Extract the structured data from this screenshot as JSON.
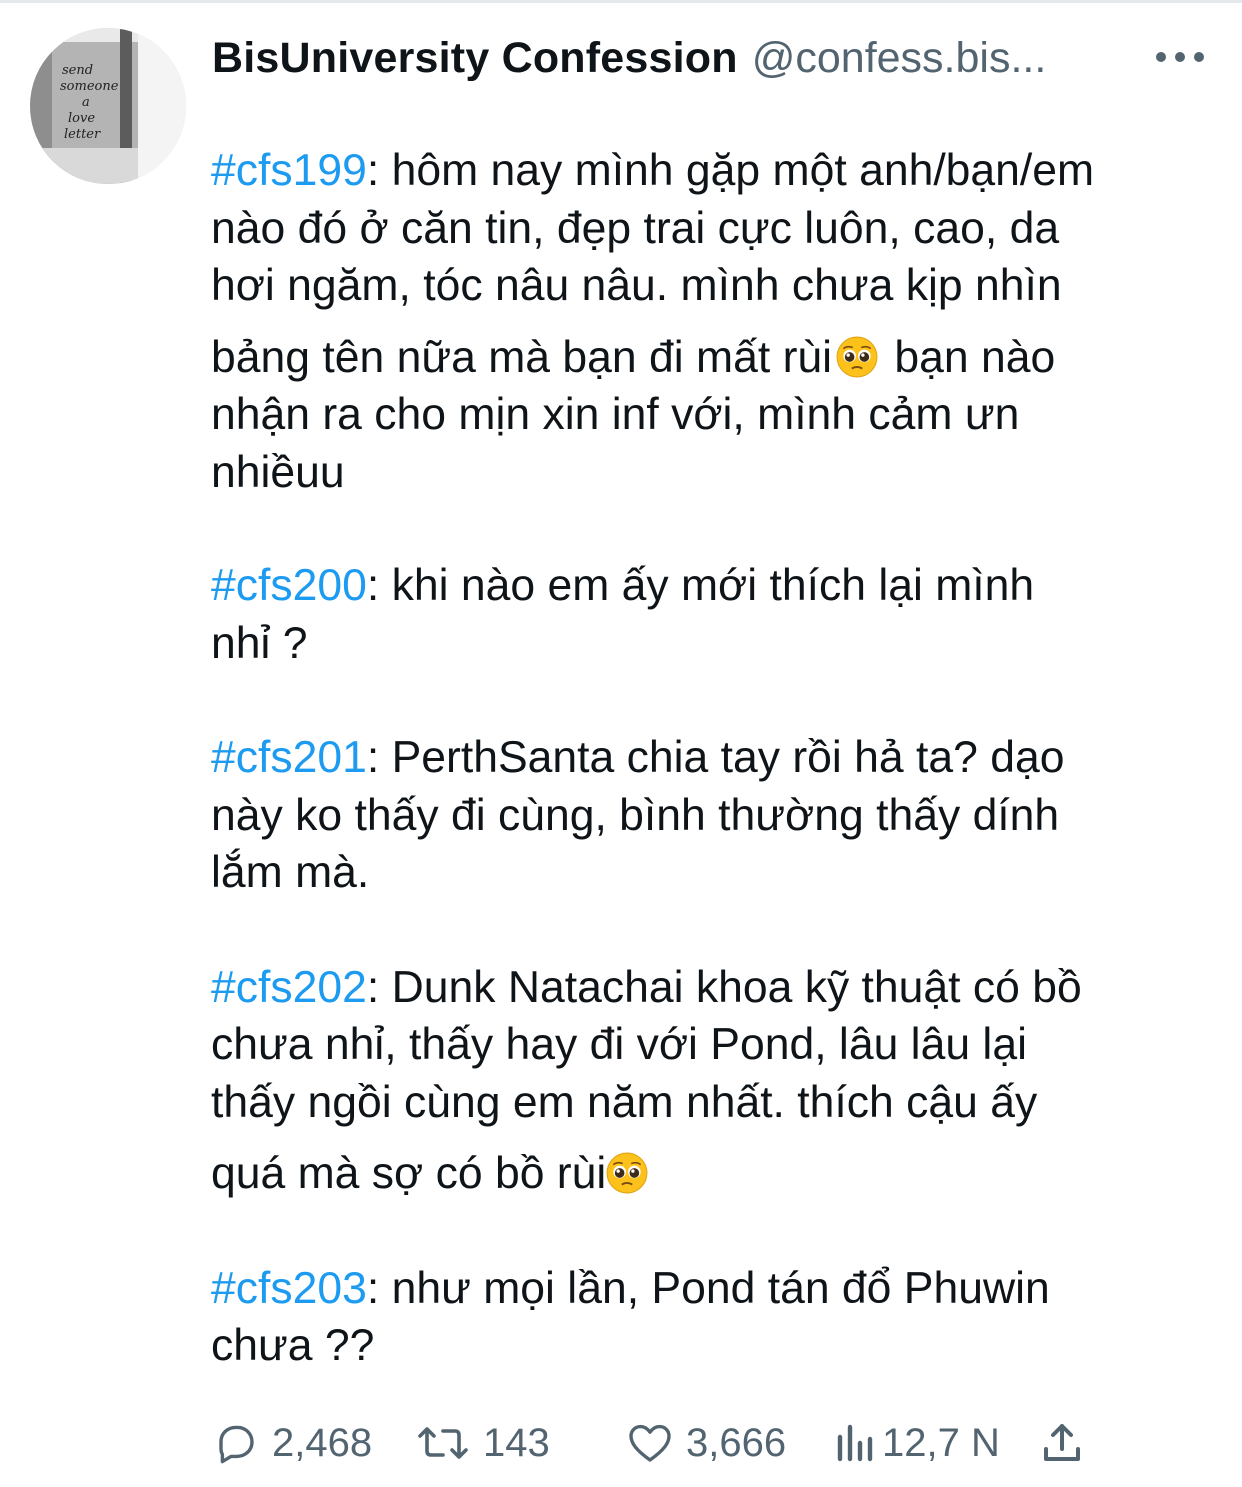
{
  "tweet": {
    "display_name": "BisUniversity Confession",
    "handle": "@confess.bis...",
    "avatar_text": [
      "send",
      "someone",
      "a",
      "love",
      "letter"
    ],
    "more_icon": "more-horizontal-icon",
    "paragraphs": [
      {
        "tag": "#cfs199",
        "lines": [
          ": hôm nay mình gặp một anh/bạn/em",
          "nào đó ở căn tin, đẹp trai cực luôn, cao, da",
          "hơi ngăm, tóc nâu nâu. mình chưa kịp nhìn",
          "bảng tên nữa mà bạn đi mất rùi",
          " bạn nào",
          "nhận ra cho mịn xin inf với, mình cảm ưn",
          "nhiềuu"
        ]
      },
      {
        "tag": "#cfs200",
        "lines": [
          ": khi nào em ấy mới thích lại mình",
          "nhỉ ?"
        ]
      },
      {
        "tag": "#cfs201",
        "lines": [
          ": PerthSanta chia tay rồi hả ta? dạo",
          "này ko thấy đi cùng, bình thường thấy dính",
          "lắm mà."
        ]
      },
      {
        "tag": "#cfs202",
        "lines": [
          ": Dunk Natachai khoa kỹ thuật có bồ",
          "chưa nhỉ, thấy hay đi với Pond, lâu lâu lại",
          "thấy ngồi cùng em năm nhất. thích cậu ấy",
          "quá mà sợ có bồ rùi"
        ]
      },
      {
        "tag": "#cfs203",
        "lines": [
          ": như mọi lần, Pond tán đổ Phuwin",
          "chưa ??"
        ]
      }
    ],
    "emoji": "pleading-face-emoji",
    "actions": {
      "reply": {
        "icon": "reply-icon",
        "count": "2,468"
      },
      "retweet": {
        "icon": "retweet-icon",
        "count": "143"
      },
      "like": {
        "icon": "heart-icon",
        "count": "3,666"
      },
      "views": {
        "icon": "views-icon",
        "count": "12,7 N"
      },
      "share": {
        "icon": "share-icon"
      }
    },
    "colors": {
      "hashtag": "#1d9bf0",
      "text": "#0f1419",
      "secondary": "#536471"
    }
  }
}
